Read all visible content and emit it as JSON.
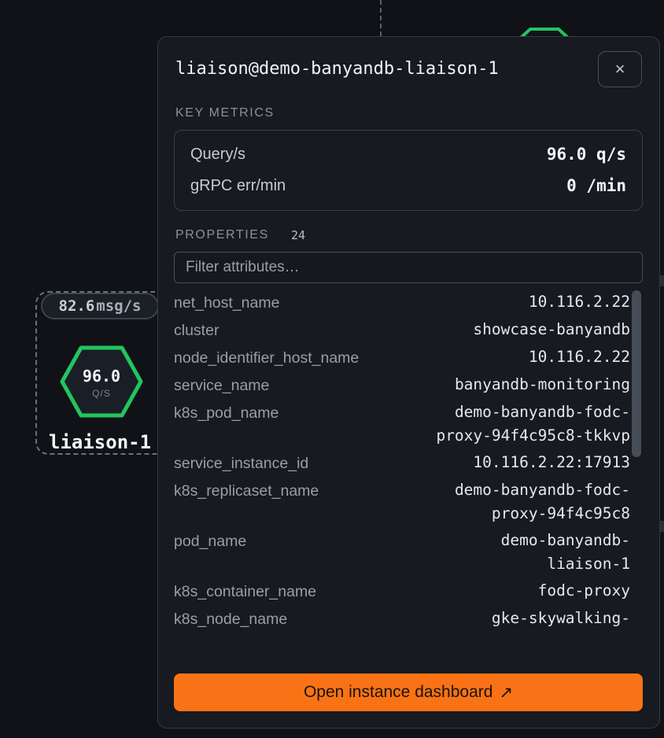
{
  "canvas": {
    "node_label": "liaison-1",
    "rate_value": "82.6",
    "rate_unit": "msg/s",
    "node_value": "96.0",
    "node_unit": "Q/S",
    "colors": {
      "healthy": "#22c55e",
      "background": "#101217"
    }
  },
  "panel": {
    "title": "liaison@demo-banyandb-liaison-1",
    "close_label": "×",
    "key_metrics_label": "KEY METRICS",
    "metrics": [
      {
        "name": "Query/s",
        "value": "96.0 q/s"
      },
      {
        "name": "gRPC err/min",
        "value": "0 /min"
      }
    ],
    "properties_label": "PROPERTIES",
    "properties_count": "24",
    "filter_placeholder": "Filter attributes…",
    "properties": [
      {
        "key": "net_host_name",
        "value": "10.116.2.22"
      },
      {
        "key": "cluster",
        "value": "showcase-banyandb"
      },
      {
        "key": "node_identifier_host_name",
        "value": "10.116.2.22"
      },
      {
        "key": "service_name",
        "value": "banyandb-monitoring"
      },
      {
        "key": "k8s_pod_name",
        "value": "demo-banyandb-fodc-proxy-94f4c95c8-tkkvp"
      },
      {
        "key": "service_instance_id",
        "value": "10.116.2.22:17913"
      },
      {
        "key": "k8s_replicaset_name",
        "value": "demo-banyandb-fodc-proxy-94f4c95c8"
      },
      {
        "key": "pod_name",
        "value": "demo-banyandb-liaison-1"
      },
      {
        "key": "k8s_container_name",
        "value": "fodc-proxy"
      },
      {
        "key": "k8s_node_name",
        "value": "gke-skywalking-"
      }
    ],
    "open_button_label": "Open instance dashboard",
    "open_button_icon": "↗",
    "accent_color": "#f97316"
  }
}
